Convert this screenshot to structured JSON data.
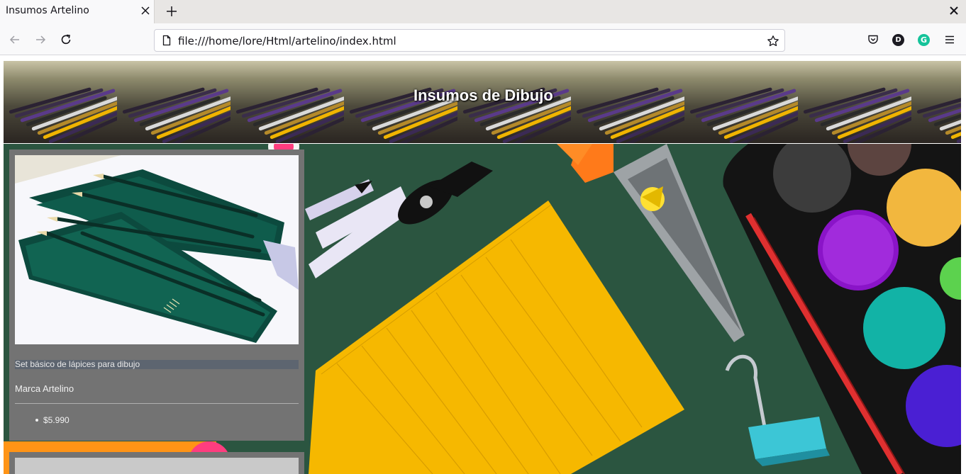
{
  "browser": {
    "tab_title": "Insumos Artelino",
    "url": "file:///home/lore/Html/artelino/index.html",
    "account_initial": "D",
    "grammarly_initial": "G"
  },
  "header": {
    "title": "Insumos de Dibujo"
  },
  "product": {
    "title": "Set básico de lápices para dibujo",
    "brand": "Marca Artelino",
    "price": "$5.990"
  },
  "icons": [
    "close-icon",
    "plus-icon",
    "back-arrow-icon",
    "forward-arrow-icon",
    "reload-icon",
    "page-icon",
    "star-icon",
    "pocket-icon",
    "hamburger-menu-icon"
  ],
  "colors": {
    "card_bg": "#737373",
    "background_green": "#2e5a44",
    "notepad_yellow": "#f6b800"
  }
}
